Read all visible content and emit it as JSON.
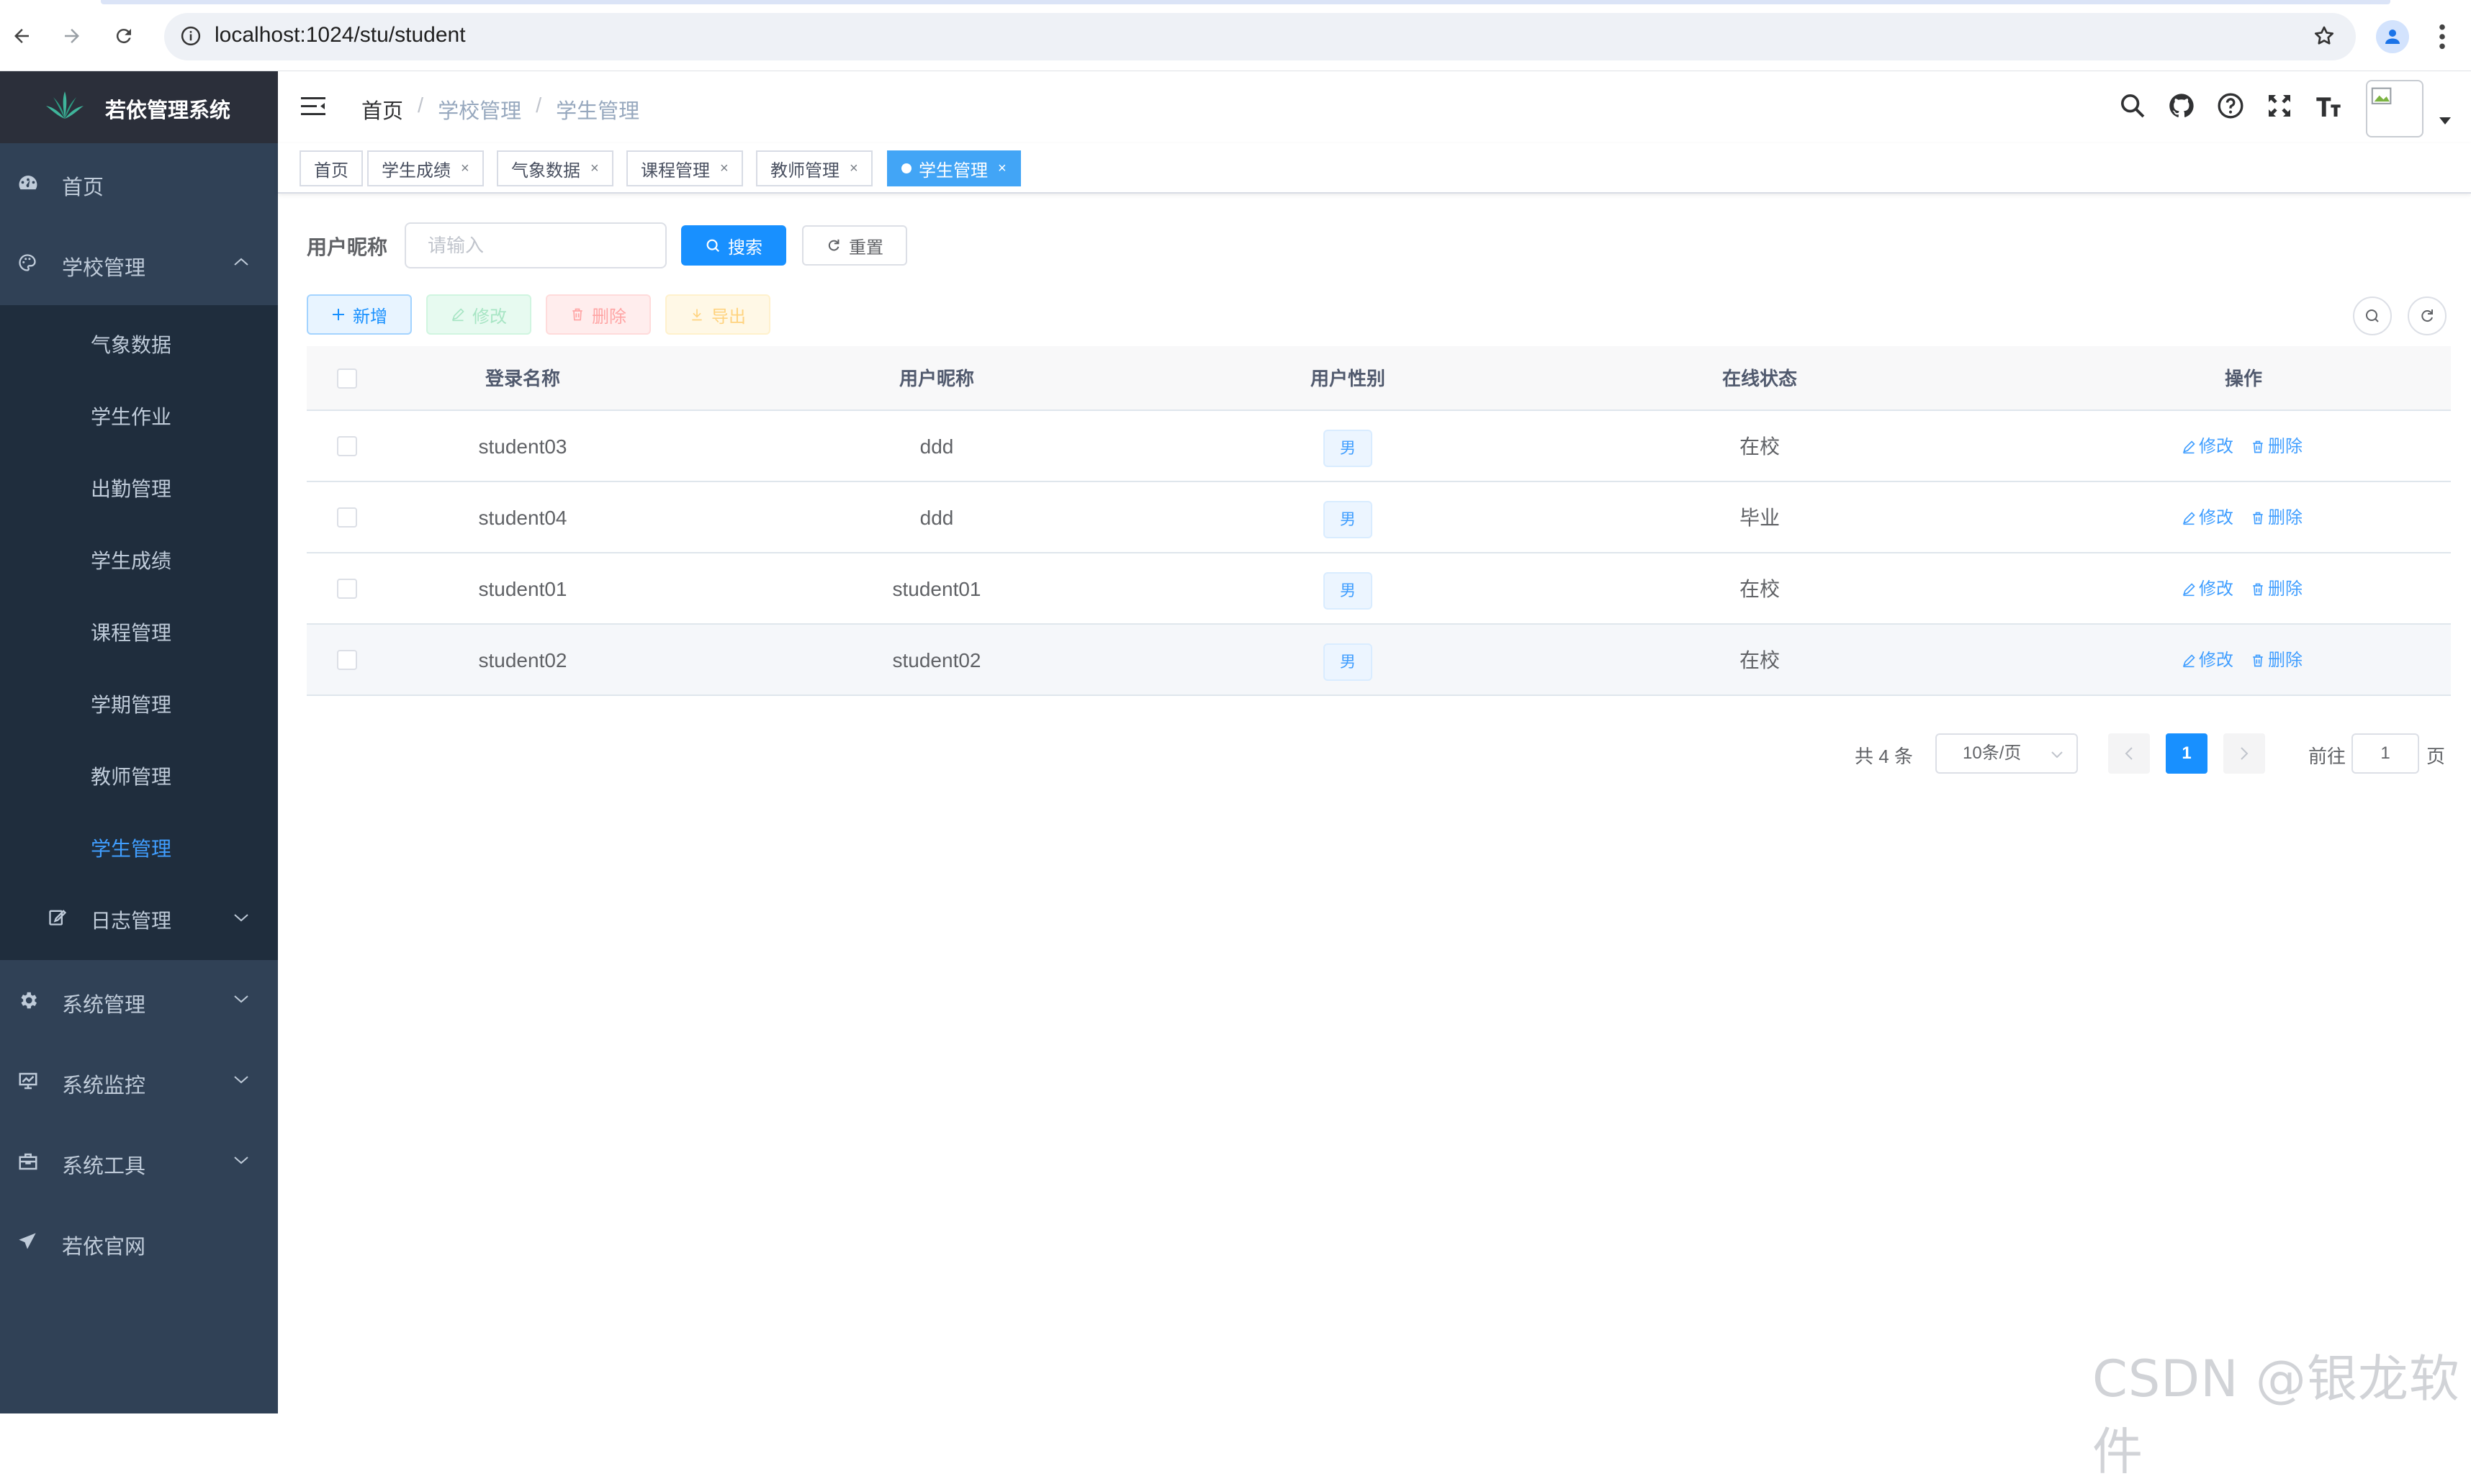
{
  "browser": {
    "url": "localhost:1024/stu/student"
  },
  "sidebar": {
    "app_title": "若依管理系统",
    "items": [
      {
        "label": "首页",
        "icon": "dashboard-icon"
      },
      {
        "label": "学校管理",
        "icon": "palette-icon",
        "expanded": true
      },
      {
        "label": "系统管理",
        "icon": "gear-icon"
      },
      {
        "label": "系统监控",
        "icon": "monitor-icon"
      },
      {
        "label": "系统工具",
        "icon": "toolbox-icon"
      },
      {
        "label": "若依官网",
        "icon": "send-icon"
      }
    ],
    "sub_items": [
      {
        "label": "气象数据"
      },
      {
        "label": "学生作业"
      },
      {
        "label": "出勤管理"
      },
      {
        "label": "学生成绩"
      },
      {
        "label": "课程管理"
      },
      {
        "label": "学期管理"
      },
      {
        "label": "教师管理"
      },
      {
        "label": "学生管理",
        "active": true
      },
      {
        "label": "日志管理",
        "icon": "edit-icon"
      }
    ]
  },
  "navbar": {
    "breadcrumb": [
      "首页",
      "学校管理",
      "学生管理"
    ],
    "separator": "/"
  },
  "tags": [
    {
      "label": "首页"
    },
    {
      "label": "学生成绩"
    },
    {
      "label": "气象数据"
    },
    {
      "label": "课程管理"
    },
    {
      "label": "教师管理"
    },
    {
      "label": "学生管理",
      "active": true
    }
  ],
  "tag_close": "×",
  "search": {
    "label": "用户昵称",
    "placeholder": "请输入",
    "search_btn": "搜索",
    "reset_btn": "重置"
  },
  "toolbar": {
    "add": "新增",
    "edit": "修改",
    "delete": "删除",
    "export": "导出"
  },
  "table": {
    "headers": [
      "登录名称",
      "用户昵称",
      "用户性别",
      "在线状态",
      "操作"
    ],
    "rows": [
      {
        "login": "student03",
        "nick": "ddd",
        "sex": "男",
        "status": "在校"
      },
      {
        "login": "student04",
        "nick": "ddd",
        "sex": "男",
        "status": "毕业"
      },
      {
        "login": "student01",
        "nick": "student01",
        "sex": "男",
        "status": "在校"
      },
      {
        "login": "student02",
        "nick": "student02",
        "sex": "男",
        "status": "在校"
      }
    ],
    "op_edit": "修改",
    "op_delete": "删除"
  },
  "pagination": {
    "total": "共 4 条",
    "page_size": "10条/页",
    "current": "1",
    "goto_prefix": "前往",
    "goto_value": "1",
    "goto_suffix": "页"
  },
  "watermark": "CSDN @银龙软件",
  "colors": {
    "sidebar_bg": "#304156",
    "submenu_bg": "#1f2d3d",
    "primary": "#1890ff",
    "active_tag": "#42a5f6"
  }
}
